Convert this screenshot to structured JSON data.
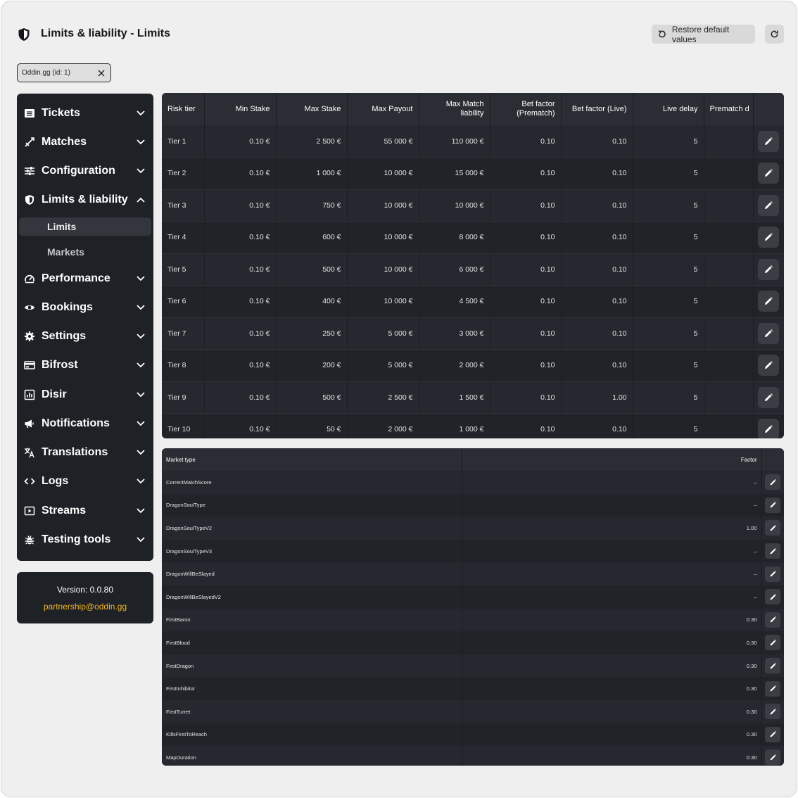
{
  "header": {
    "title": "Limits & liability - Limits",
    "restore_label": "Restore default values"
  },
  "filter_chip": {
    "label": "Oddin.gg (id: 1)"
  },
  "sidebar": {
    "items": [
      {
        "label": "Tickets",
        "icon": "ticket-icon",
        "expanded": false
      },
      {
        "label": "Matches",
        "icon": "swords-icon",
        "expanded": false
      },
      {
        "label": "Configuration",
        "icon": "sliders-icon",
        "expanded": false
      },
      {
        "label": "Limits & liability",
        "icon": "shield-icon",
        "expanded": true
      },
      {
        "label": "Performance",
        "icon": "gauge-icon",
        "expanded": false
      },
      {
        "label": "Bookings",
        "icon": "eye-icon",
        "expanded": false
      },
      {
        "label": "Settings",
        "icon": "gear-icon",
        "expanded": false
      },
      {
        "label": "Bifrost",
        "icon": "card-icon",
        "expanded": false
      },
      {
        "label": "Disir",
        "icon": "chart-icon",
        "expanded": false
      },
      {
        "label": "Notifications",
        "icon": "megaphone-icon",
        "expanded": false
      },
      {
        "label": "Translations",
        "icon": "translate-icon",
        "expanded": false
      },
      {
        "label": "Logs",
        "icon": "code-icon",
        "expanded": false
      },
      {
        "label": "Streams",
        "icon": "play-icon",
        "expanded": false
      },
      {
        "label": "Testing tools",
        "icon": "bug-icon",
        "expanded": false
      }
    ],
    "subitems": [
      {
        "label": "Limits",
        "active": true
      },
      {
        "label": "Markets",
        "active": false
      }
    ]
  },
  "info": {
    "version": "Version: 0.0.80",
    "email": "partnership@oddin.gg"
  },
  "limits_table": {
    "columns": [
      "Risk tier",
      "Min Stake",
      "Max Stake",
      "Max Payout",
      "Max Match liability",
      "Bet factor (Prematch)",
      "Bet factor (Live)",
      "Live delay",
      "Prematch d"
    ],
    "rows": [
      [
        "Tier 1",
        "0.10 €",
        "2 500 €",
        "55 000 €",
        "110 000 €",
        "0.10",
        "0.10",
        "5",
        ""
      ],
      [
        "Tier 2",
        "0.10 €",
        "1 000 €",
        "10 000 €",
        "15 000 €",
        "0.10",
        "0.10",
        "5",
        ""
      ],
      [
        "Tier 3",
        "0.10 €",
        "750 €",
        "10 000 €",
        "10 000 €",
        "0.10",
        "0.10",
        "5",
        ""
      ],
      [
        "Tier 4",
        "0.10 €",
        "600 €",
        "10 000 €",
        "8 000 €",
        "0.10",
        "0.10",
        "5",
        ""
      ],
      [
        "Tier 5",
        "0.10 €",
        "500 €",
        "10 000 €",
        "6 000 €",
        "0.10",
        "0.10",
        "5",
        ""
      ],
      [
        "Tier 6",
        "0.10 €",
        "400 €",
        "10 000 €",
        "4 500 €",
        "0.10",
        "0.10",
        "5",
        ""
      ],
      [
        "Tier 7",
        "0.10 €",
        "250 €",
        "5 000 €",
        "3 000 €",
        "0.10",
        "0.10",
        "5",
        ""
      ],
      [
        "Tier 8",
        "0.10 €",
        "200 €",
        "5 000 €",
        "2 000 €",
        "0.10",
        "0.10",
        "5",
        ""
      ],
      [
        "Tier 9",
        "0.10 €",
        "500 €",
        "2 500 €",
        "1 500 €",
        "0.10",
        "1.00",
        "5",
        ""
      ],
      [
        "Tier 10",
        "0.10 €",
        "50 €",
        "2 000 €",
        "1 000 €",
        "0.10",
        "0.10",
        "5",
        ""
      ]
    ]
  },
  "market_table": {
    "columns": [
      "Market type",
      "Factor"
    ],
    "rows": [
      [
        "CorrectMatchScore",
        "–"
      ],
      [
        "DragonSoulType",
        "–"
      ],
      [
        "DragonSoulTypeV2",
        "1.00"
      ],
      [
        "DragonSoulTypeV3",
        "–"
      ],
      [
        "DragonWillBeSlayed",
        "–"
      ],
      [
        "DragonWillBeSlayedV2",
        "–"
      ],
      [
        "FirstBaron",
        "0.30"
      ],
      [
        "FirstBlood",
        "0.30"
      ],
      [
        "FirstDragon",
        "0.30"
      ],
      [
        "FirstInhibitor",
        "0.30"
      ],
      [
        "FirstTurret",
        "0.30"
      ],
      [
        "KillsFirstToReach",
        "0.30"
      ],
      [
        "MapDuration",
        "0.30"
      ]
    ]
  }
}
